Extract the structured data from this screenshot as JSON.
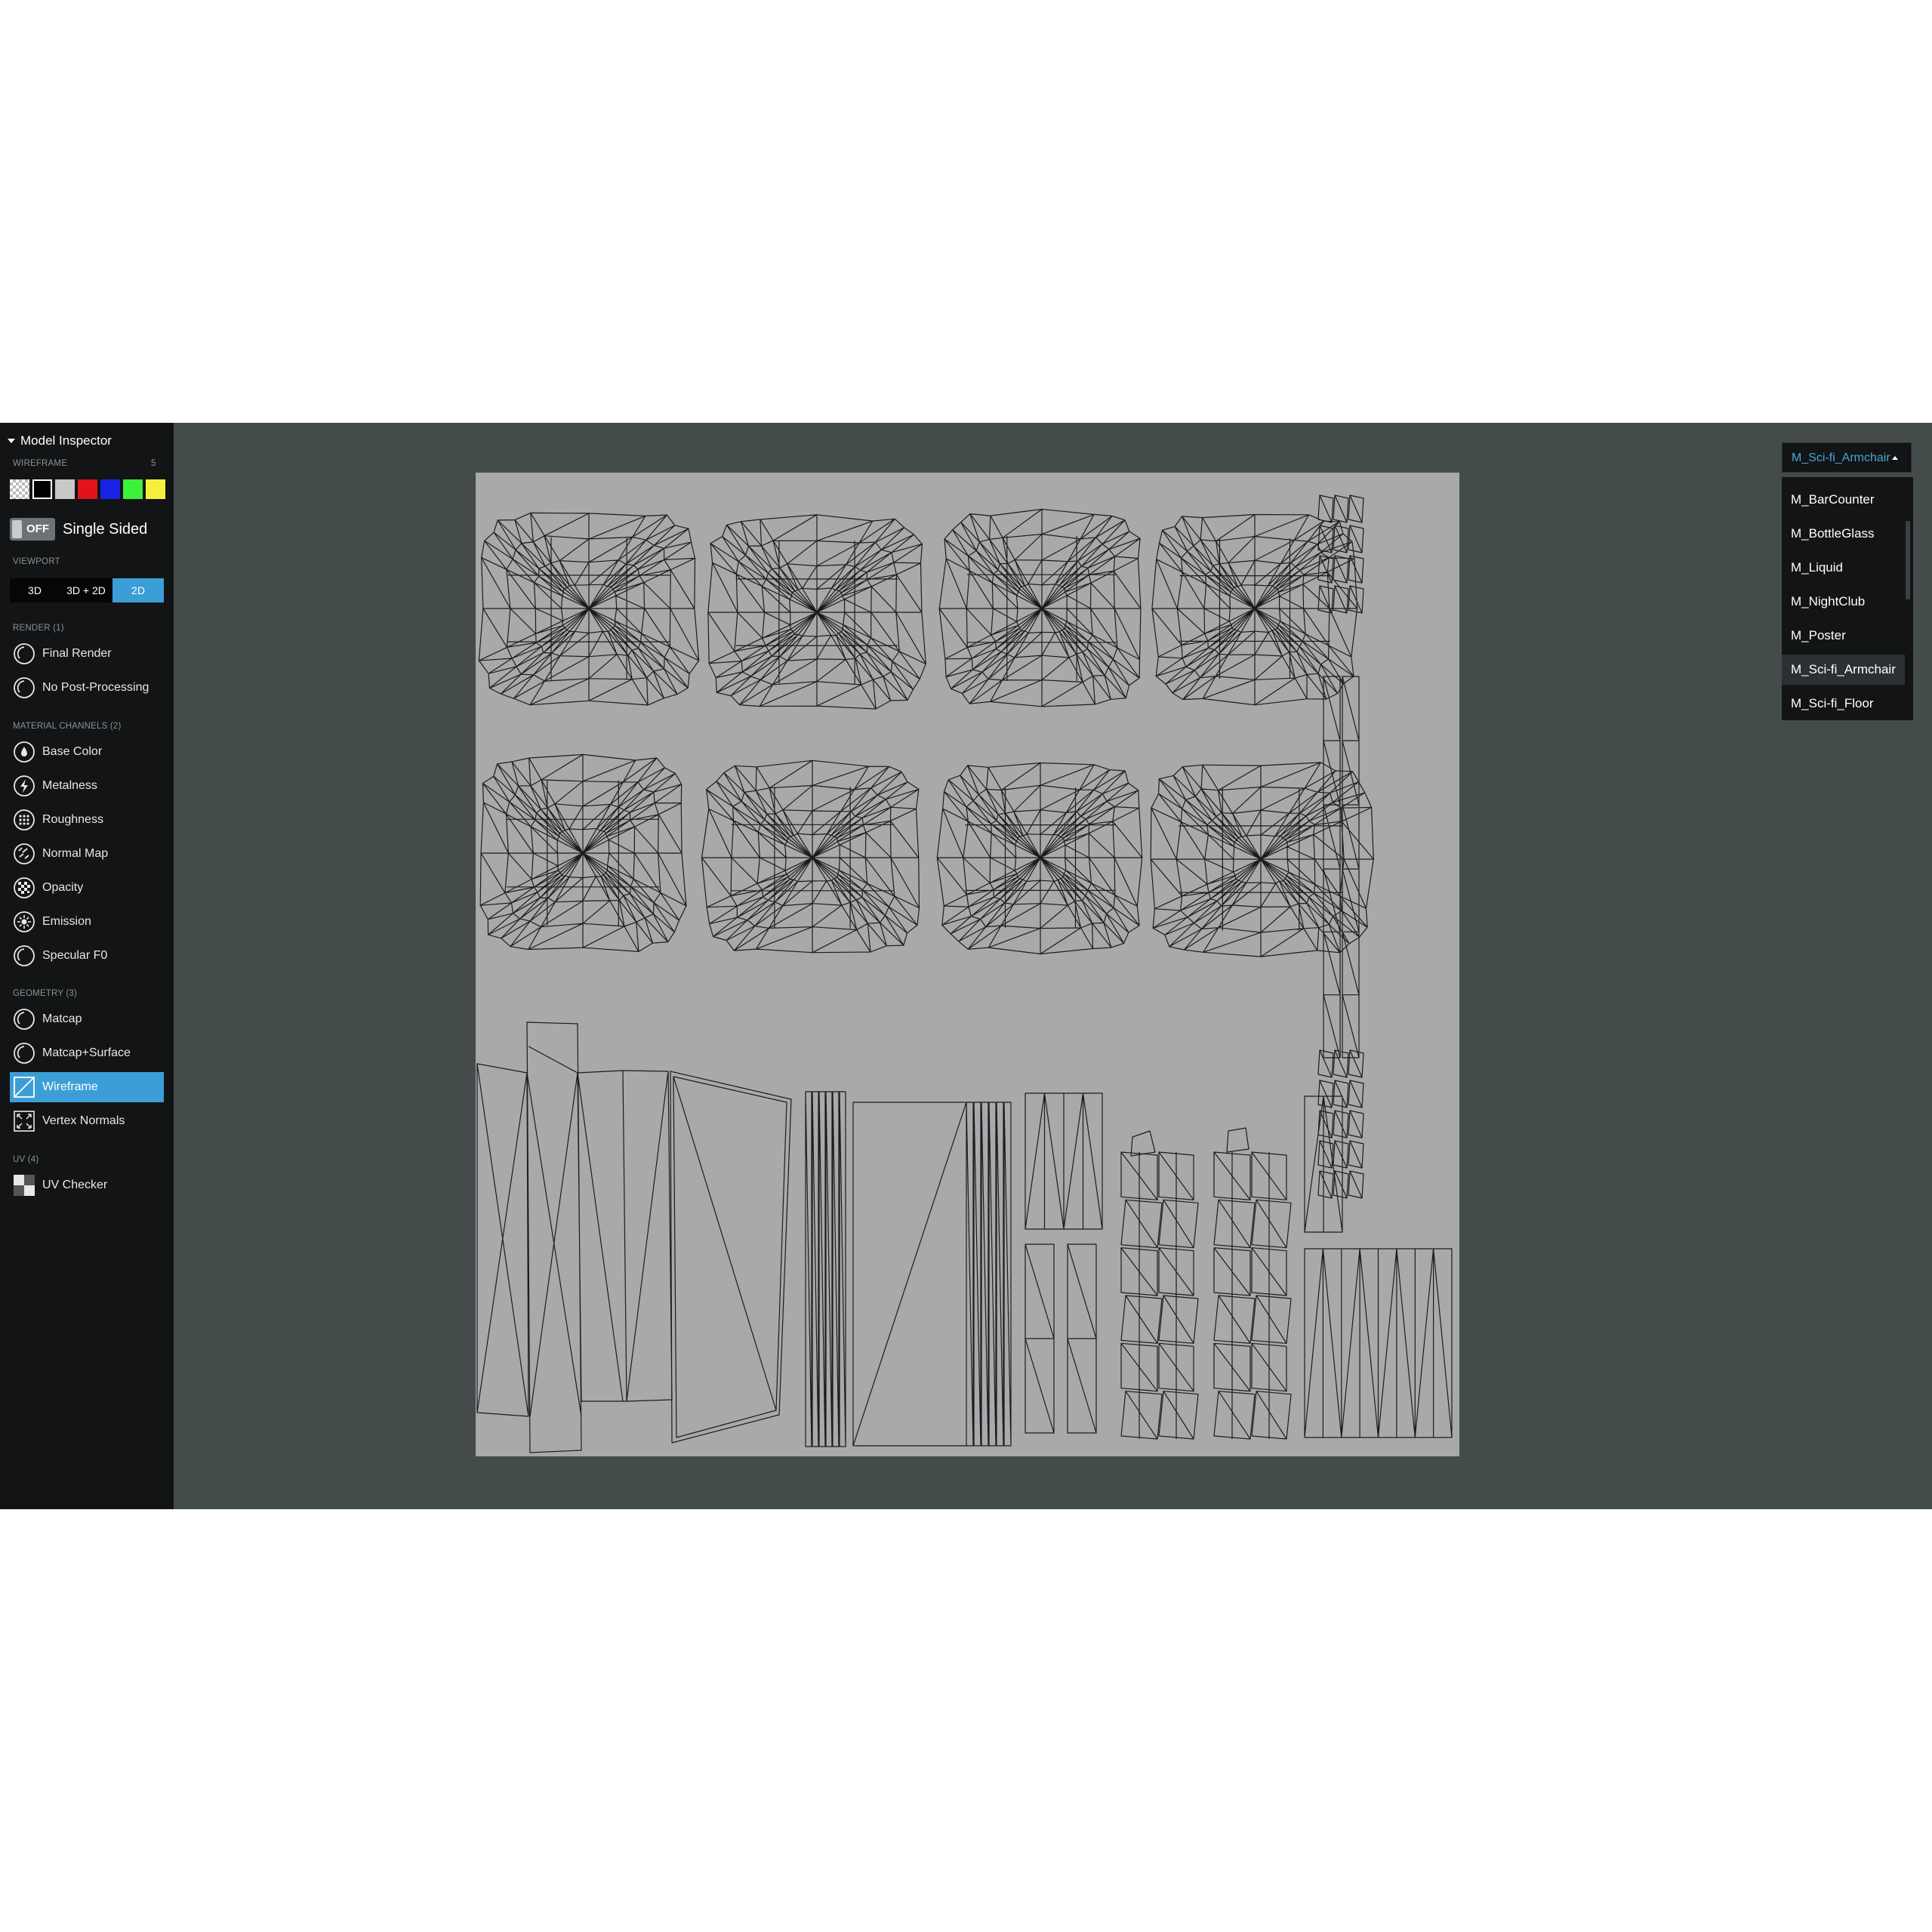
{
  "sidebar": {
    "panel_title": "Model Inspector",
    "wireframe": {
      "label": "WIREFRAME",
      "count": "5",
      "colors": [
        "checker",
        "#000000",
        "#c8c8c8",
        "#e0141a",
        "#1a22e6",
        "#3cf03c",
        "#f5f03c"
      ]
    },
    "single_sided": {
      "state": "OFF",
      "label": "Single Sided"
    },
    "viewport": {
      "label": "VIEWPORT",
      "options": [
        "3D",
        "3D + 2D",
        "2D"
      ],
      "active": "2D"
    },
    "render": {
      "label": "RENDER (1)",
      "items": [
        "Final Render",
        "No Post-Processing"
      ]
    },
    "material_channels": {
      "label": "MATERIAL CHANNELS (2)",
      "items": [
        "Base Color",
        "Metalness",
        "Roughness",
        "Normal Map",
        "Opacity",
        "Emission",
        "Specular F0"
      ]
    },
    "geometry": {
      "label": "GEOMETRY (3)",
      "items": [
        "Matcap",
        "Matcap+Surface",
        "Wireframe",
        "Vertex Normals"
      ],
      "active": "Wireframe"
    },
    "uv": {
      "label": "UV (4)",
      "items": [
        "UV Checker"
      ]
    }
  },
  "material_selector": {
    "selected": "M_Sci-fi_Armchair",
    "options": [
      "M_BarCounter",
      "M_BottleGlass",
      "M_Liquid",
      "M_NightClub",
      "M_Poster",
      "M_Sci-fi_Armchair",
      "M_Sci-fi_Floor"
    ]
  },
  "colors": {
    "accent": "#3c9ed6",
    "sidebar_bg": "#121415",
    "viewport_bg": "#434c4b",
    "uv_bg": "#a8a9ab"
  }
}
